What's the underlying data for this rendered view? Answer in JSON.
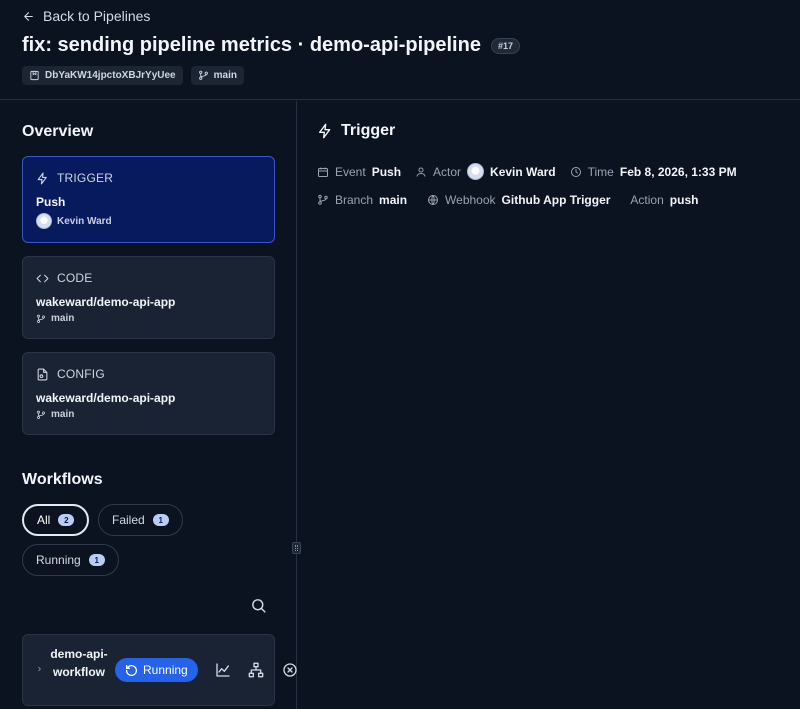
{
  "header": {
    "back_label": "Back to Pipelines",
    "title": "fix: sending pipeline metrics · demo-api-pipeline",
    "run_number": "#17",
    "commit_id": "DbYaKW14jpctoXBJrYyUee",
    "branch": "main"
  },
  "overview": {
    "heading": "Overview",
    "cards": [
      {
        "label": "TRIGGER",
        "icon": "lightning-icon",
        "main": "Push",
        "sub": "Kevin Ward",
        "sub_icon": "avatar"
      },
      {
        "label": "CODE",
        "icon": "code-icon",
        "main": "wakeward/demo-api-app",
        "sub": "main",
        "sub_icon": "branch-icon"
      },
      {
        "label": "CONFIG",
        "icon": "config-file-icon",
        "main": "wakeward/demo-api-app",
        "sub": "main",
        "sub_icon": "branch-icon"
      }
    ]
  },
  "workflows": {
    "heading": "Workflows",
    "filters": [
      {
        "label": "All",
        "count": "2",
        "active": true
      },
      {
        "label": "Failed",
        "count": "1",
        "active": false
      },
      {
        "label": "Running",
        "count": "1",
        "active": false
      }
    ],
    "items": [
      {
        "name": "demo-api-workflow",
        "status": "Running"
      }
    ]
  },
  "trigger_detail": {
    "heading": "Trigger",
    "event_label": "Event",
    "event_value": "Push",
    "actor_label": "Actor",
    "actor_value": "Kevin Ward",
    "time_label": "Time",
    "time_value": "Feb 8, 2026, 1:33 PM",
    "branch_label": "Branch",
    "branch_value": "main",
    "webhook_label": "Webhook",
    "webhook_value": "Github App Trigger",
    "action_label": "Action",
    "action_value": "push"
  },
  "colors": {
    "background": "#0b1220",
    "active_card": "#081a5e",
    "accent": "#2563eb",
    "badge": "#b9cdf7"
  }
}
